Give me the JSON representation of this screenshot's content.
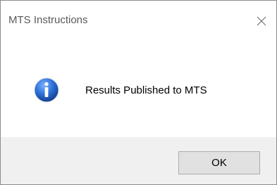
{
  "window": {
    "title": "MTS Instructions"
  },
  "titlebar": {
    "close_icon": "close-icon"
  },
  "content": {
    "icon": "info-icon",
    "message": "Results Published to MTS"
  },
  "footer": {
    "ok_label": "OK"
  },
  "colors": {
    "footer_background": "#f0f0f0",
    "button_background": "#e1e1e1",
    "button_border": "#adadad",
    "info_icon_blue": "#1f5fc0"
  }
}
